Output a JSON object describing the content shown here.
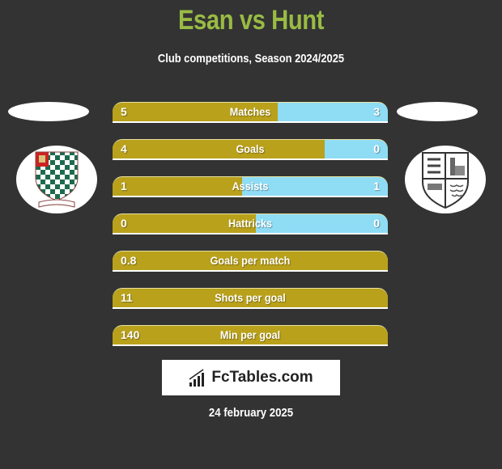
{
  "header": {
    "title": "Esan vs Hunt",
    "subtitle": "Club competitions, Season 2024/2025"
  },
  "teams": {
    "home": {
      "name": "Esan",
      "crest_icon": "checkered-shield-crest-icon"
    },
    "away": {
      "name": "Hunt",
      "crest_icon": "quartered-shield-crest-icon"
    }
  },
  "colors": {
    "title": "#99bb44",
    "home_bar": "#b9a11b",
    "away_bar": "#8fdcf5",
    "background": "#333333"
  },
  "stats": [
    {
      "label": "Matches",
      "left": "5",
      "right": "3",
      "home_fill": 0.6
    },
    {
      "label": "Goals",
      "left": "4",
      "right": "0",
      "home_fill": 0.77
    },
    {
      "label": "Assists",
      "left": "1",
      "right": "1",
      "home_fill": 0.47
    },
    {
      "label": "Hattricks",
      "left": "0",
      "right": "0",
      "home_fill": 0.52
    },
    {
      "label": "Goals per match",
      "left": "0.8",
      "right": "",
      "home_fill": 1.0
    },
    {
      "label": "Shots per goal",
      "left": "11",
      "right": "",
      "home_fill": 1.0
    },
    {
      "label": "Min per goal",
      "left": "140",
      "right": "",
      "home_fill": 1.0
    }
  ],
  "footer": {
    "brand": "FcTables.com",
    "brand_icon": "bar-chart-icon",
    "date": "24 february 2025"
  }
}
